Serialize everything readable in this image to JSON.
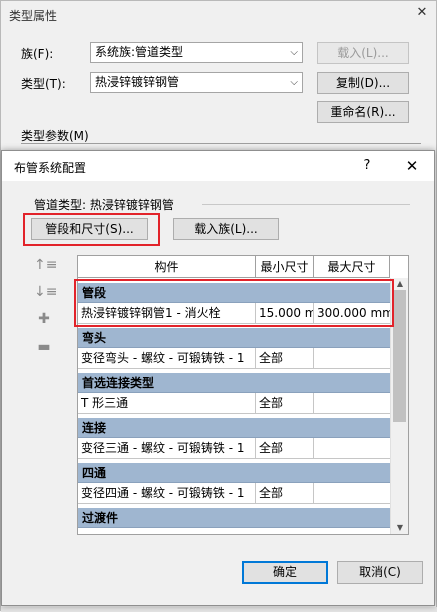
{
  "bg": {
    "title": "类型属性",
    "family_label": "族(F):",
    "family_value": "系统族:管道类型",
    "type_label": "类型(T):",
    "type_value": "热浸锌镀锌钢管",
    "load_button": "载入(L)...",
    "copy_button": "复制(D)...",
    "rename_button": "重命名(R)...",
    "type_params_label": "类型参数(M)"
  },
  "dialog": {
    "title": "布管系统配置",
    "help_icon": "?",
    "close_icon": "✕",
    "pipe_type_label": "管道类型: 热浸锌镀锌钢管",
    "segments_button": "管段和尺寸(S)...",
    "load_family_button": "载入族(L)...",
    "ok_button": "确定",
    "cancel_button": "取消(C)"
  },
  "grid": {
    "columns": [
      "构件",
      "最小尺寸",
      "最大尺寸"
    ],
    "groups": [
      {
        "header": "管段",
        "rows": [
          [
            "热浸锌镀锌钢管1 - 消火栓",
            "15.000 m",
            "300.000 mm"
          ]
        ]
      },
      {
        "header": "弯头",
        "rows": [
          [
            "变径弯头 - 螺纹 - 可锻铸铁 - 1",
            "全部",
            ""
          ]
        ]
      },
      {
        "header": "首选连接类型",
        "rows": [
          [
            "T 形三通",
            "全部",
            ""
          ]
        ]
      },
      {
        "header": "连接",
        "rows": [
          [
            "变径三通 - 螺纹 - 可锻铸铁 - 1",
            "全部",
            ""
          ]
        ]
      },
      {
        "header": "四通",
        "rows": [
          [
            "变径四通 - 螺纹 - 可锻铸铁 - 1",
            "全部",
            ""
          ]
        ]
      },
      {
        "header": "过渡件",
        "rows": []
      }
    ]
  },
  "colors": {
    "group_header": "#9fb6d0",
    "highlight_red": "#e2232a"
  }
}
